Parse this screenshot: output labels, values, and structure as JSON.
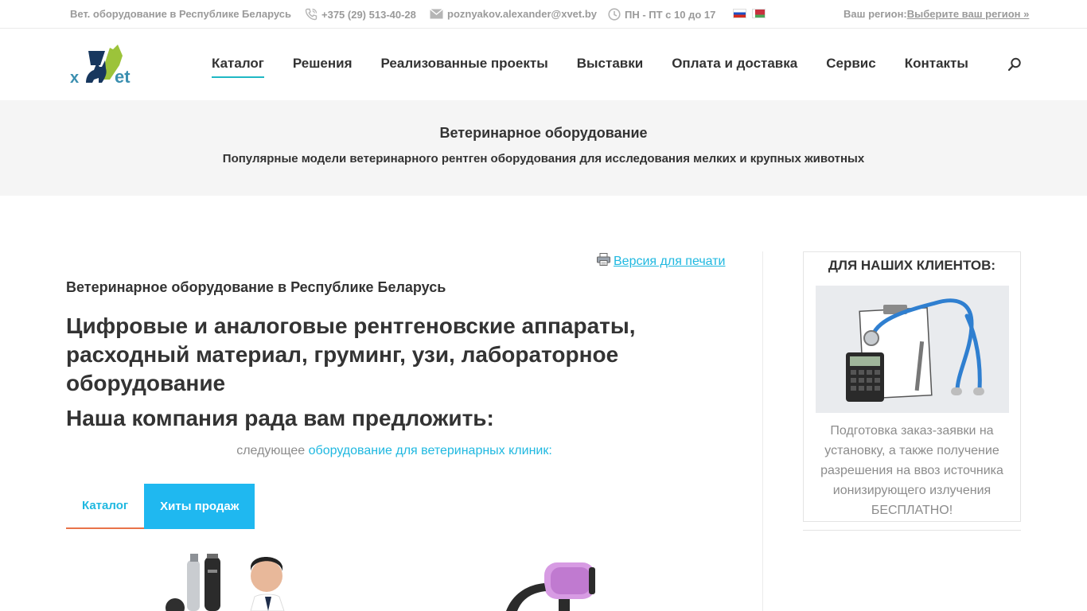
{
  "topbar": {
    "tagline": "Вет. оборудование в Республике Беларусь",
    "phone": "+375 (29) 513-40-28",
    "email": "poznyakov.alexander@xvet.by",
    "hours": "ПН - ПТ с 10 до 17",
    "region_label": "Ваш регион:",
    "region_link": "Выберите ваш регион »",
    "icons": [
      "phone-icon",
      "mail-icon",
      "clock-icon"
    ],
    "languages": [
      "flag-ru",
      "flag-by"
    ]
  },
  "header": {
    "logo_text": "xVet",
    "nav": [
      {
        "label": "Каталог",
        "active": true
      },
      {
        "label": "Решения"
      },
      {
        "label": "Реализованные проекты"
      },
      {
        "label": "Выставки"
      },
      {
        "label": "Оплата и доставка"
      },
      {
        "label": "Сервис"
      },
      {
        "label": "Контакты"
      }
    ],
    "accent_color": "#1fb8c4"
  },
  "titleband": {
    "title": "Ветеринарное оборудование",
    "subtitle": "Популярные модели ветеринарного рентген оборудования для исследования мелких и крупных животных"
  },
  "main": {
    "print_link": " Версия для печати",
    "region_heading": "Ветеринарное оборудование в Республике Беларусь",
    "big_heading": "Цифровые и аналоговые рентгеновские аппараты, расходный материал, груминг, узи, лабораторное оборудование",
    "offer_heading": "Наша компания рада вам предложить:",
    "lead_prefix": "следующее ",
    "lead_link": "оборудование для ветеринарных клиник",
    "lead_suffix": ":",
    "tabs": [
      {
        "label": "Каталог",
        "active": true
      },
      {
        "label": "Хиты продаж"
      }
    ]
  },
  "sidebar": {
    "title": "ДЛЯ НАШИХ КЛИЕНТОВ:",
    "text": "Подготовка заказ-заявки на установку, а также получение разрешения на ввоз источника ионизирующего излучения БЕСПЛАТНО!"
  }
}
